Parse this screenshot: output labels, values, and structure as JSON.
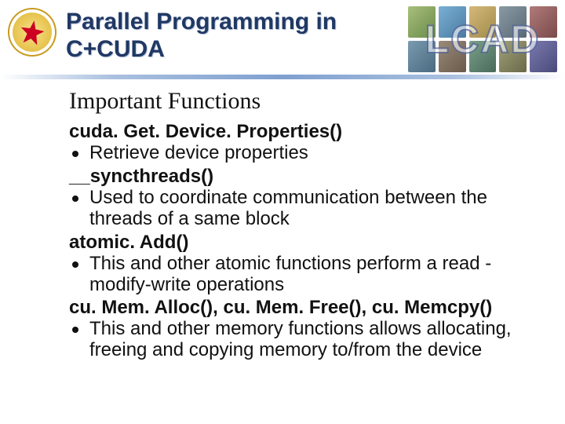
{
  "header": {
    "title_line1": "Parallel Programming in",
    "title_line2": "C+CUDA",
    "right_badge": "LCAD"
  },
  "content": {
    "heading": "Important Functions",
    "items": [
      {
        "name": "cuda. Get. Device. Properties()",
        "desc": "Retrieve device properties"
      },
      {
        "name": "__syncthreads()",
        "desc": "Used to coordinate communication between the threads of a same block"
      },
      {
        "name": "atomic. Add()",
        "desc": "This and other atomic functions perform a read -modify-write operations"
      },
      {
        "name": "cu. Mem. Alloc(), cu. Mem. Free(), cu. Memcpy()",
        "desc": "This and other memory functions allows allocating, freeing and copying memory to/from the device"
      }
    ]
  }
}
